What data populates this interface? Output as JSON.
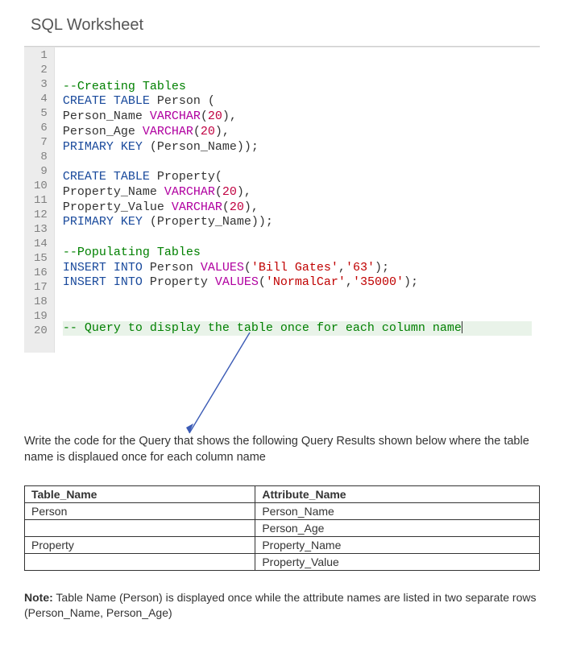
{
  "title": "SQL Worksheet",
  "editor": {
    "lines": [
      {
        "n": 1,
        "tokens": [],
        "hl": false
      },
      {
        "n": 2,
        "tokens": [],
        "hl": false
      },
      {
        "n": 3,
        "tokens": [
          {
            "t": "--Creating Tables",
            "c": "c-green"
          }
        ],
        "hl": false
      },
      {
        "n": 4,
        "tokens": [
          {
            "t": "CREATE TABLE",
            "c": "c-blue"
          },
          {
            "t": " Person (",
            "c": "c-plain"
          }
        ],
        "hl": false
      },
      {
        "n": 5,
        "tokens": [
          {
            "t": "Person_Name ",
            "c": "c-plain"
          },
          {
            "t": "VARCHAR",
            "c": "c-mag"
          },
          {
            "t": "(",
            "c": "c-plain"
          },
          {
            "t": "20",
            "c": "c-red"
          },
          {
            "t": "),",
            "c": "c-plain"
          }
        ],
        "hl": false
      },
      {
        "n": 6,
        "tokens": [
          {
            "t": "Person_Age ",
            "c": "c-plain"
          },
          {
            "t": "VARCHAR",
            "c": "c-mag"
          },
          {
            "t": "(",
            "c": "c-plain"
          },
          {
            "t": "20",
            "c": "c-red"
          },
          {
            "t": "),",
            "c": "c-plain"
          }
        ],
        "hl": false
      },
      {
        "n": 7,
        "tokens": [
          {
            "t": "PRIMARY KEY",
            "c": "c-blue"
          },
          {
            "t": " (Person_Name));",
            "c": "c-plain"
          }
        ],
        "hl": false
      },
      {
        "n": 8,
        "tokens": [],
        "hl": false
      },
      {
        "n": 9,
        "tokens": [
          {
            "t": "CREATE TABLE",
            "c": "c-blue"
          },
          {
            "t": " Property(",
            "c": "c-plain"
          }
        ],
        "hl": false
      },
      {
        "n": 10,
        "tokens": [
          {
            "t": "Property_Name ",
            "c": "c-plain"
          },
          {
            "t": "VARCHAR",
            "c": "c-mag"
          },
          {
            "t": "(",
            "c": "c-plain"
          },
          {
            "t": "20",
            "c": "c-red"
          },
          {
            "t": "),",
            "c": "c-plain"
          }
        ],
        "hl": false
      },
      {
        "n": 11,
        "tokens": [
          {
            "t": "Property_Value ",
            "c": "c-plain"
          },
          {
            "t": "VARCHAR",
            "c": "c-mag"
          },
          {
            "t": "(",
            "c": "c-plain"
          },
          {
            "t": "20",
            "c": "c-red"
          },
          {
            "t": "),",
            "c": "c-plain"
          }
        ],
        "hl": false
      },
      {
        "n": 12,
        "tokens": [
          {
            "t": "PRIMARY KEY",
            "c": "c-blue"
          },
          {
            "t": " (Property_Name));",
            "c": "c-plain"
          }
        ],
        "hl": false
      },
      {
        "n": 13,
        "tokens": [],
        "hl": false
      },
      {
        "n": 14,
        "tokens": [
          {
            "t": "--Populating Tables",
            "c": "c-green"
          }
        ],
        "hl": false
      },
      {
        "n": 15,
        "tokens": [
          {
            "t": "INSERT INTO",
            "c": "c-blue"
          },
          {
            "t": " Person ",
            "c": "c-plain"
          },
          {
            "t": "VALUES",
            "c": "c-mag"
          },
          {
            "t": "(",
            "c": "c-plain"
          },
          {
            "t": "'Bill Gates'",
            "c": "c-str"
          },
          {
            "t": ",",
            "c": "c-plain"
          },
          {
            "t": "'63'",
            "c": "c-str"
          },
          {
            "t": ");",
            "c": "c-plain"
          }
        ],
        "hl": false
      },
      {
        "n": 16,
        "tokens": [
          {
            "t": "INSERT INTO",
            "c": "c-blue"
          },
          {
            "t": " Property ",
            "c": "c-plain"
          },
          {
            "t": "VALUES",
            "c": "c-mag"
          },
          {
            "t": "(",
            "c": "c-plain"
          },
          {
            "t": "'NormalCar'",
            "c": "c-str"
          },
          {
            "t": ",",
            "c": "c-plain"
          },
          {
            "t": "'35000'",
            "c": "c-str"
          },
          {
            "t": ");",
            "c": "c-plain"
          }
        ],
        "hl": false
      },
      {
        "n": 17,
        "tokens": [],
        "hl": false
      },
      {
        "n": 18,
        "tokens": [],
        "hl": false
      },
      {
        "n": 19,
        "tokens": [
          {
            "t": "-- Query to display the table once for each column name",
            "c": "c-green"
          }
        ],
        "hl": true
      },
      {
        "n": 20,
        "tokens": [],
        "hl": false
      }
    ]
  },
  "prompt": "Write the code for the Query that shows the following Query Results shown below where the table name is displaued once for each column name",
  "table": {
    "headers": [
      "Table_Name",
      "Attribute_Name"
    ],
    "rows": [
      [
        "Person",
        "Person_Name"
      ],
      [
        "",
        "Person_Age"
      ],
      [
        "Property",
        "Property_Name"
      ],
      [
        "",
        "Property_Value"
      ]
    ]
  },
  "note_label": "Note:",
  "note_text": " Table Name (Person)  is displayed once while the attribute names are listed in two separate rows (Person_Name, Person_Age)"
}
